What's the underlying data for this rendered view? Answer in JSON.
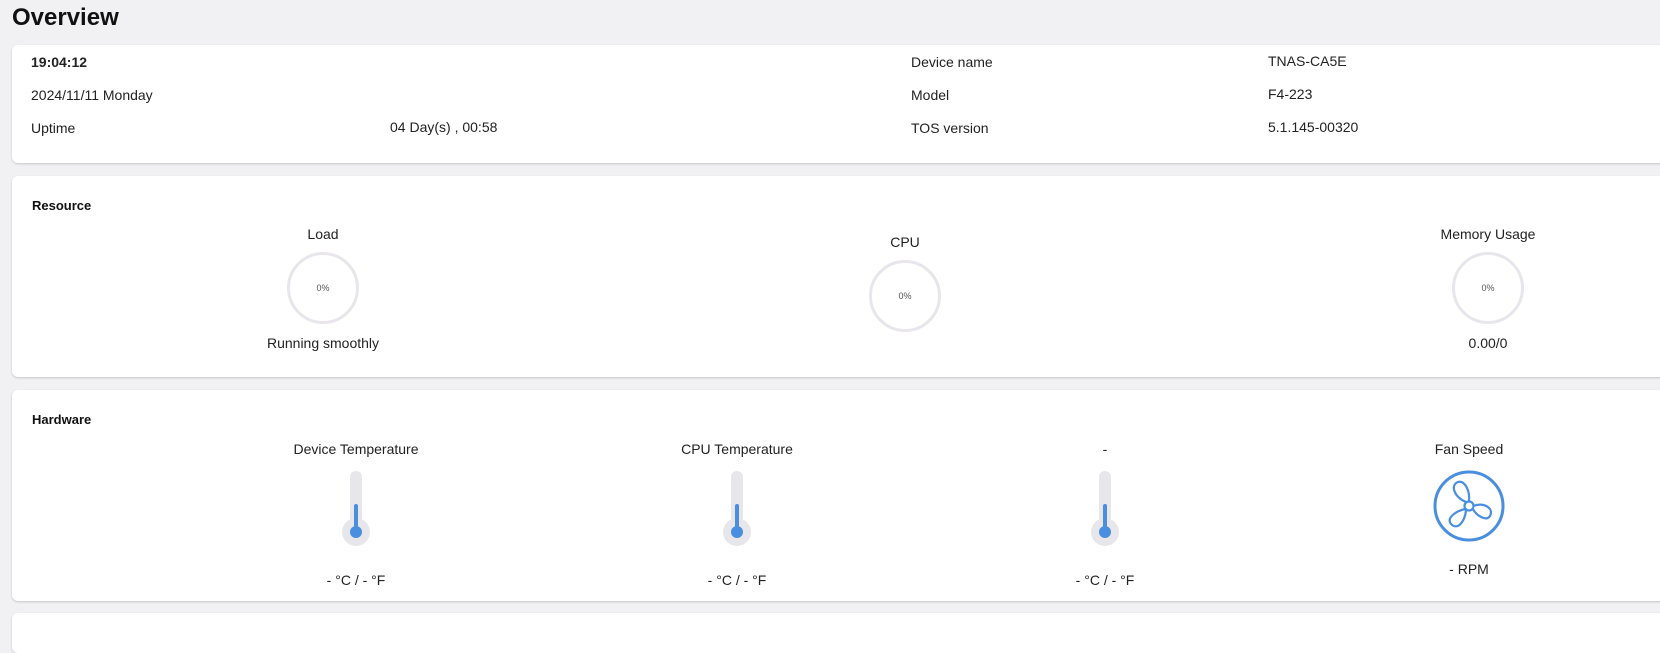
{
  "page": {
    "title": "Overview"
  },
  "info": {
    "time": "19:04:12",
    "date": "2024/11/11 Monday",
    "uptime_label": "Uptime",
    "uptime_value": "04 Day(s) , 00:58",
    "device_name_label": "Device name",
    "device_name_value": "TNAS-CA5E",
    "model_label": "Model",
    "model_value": "F4-223",
    "tos_label": "TOS version",
    "tos_value": "5.1.145-00320"
  },
  "resource": {
    "title": "Resource",
    "load": {
      "label": "Load",
      "percent_text": "0%",
      "status": "Running smoothly"
    },
    "cpu": {
      "label": "CPU",
      "percent_text": "0%"
    },
    "memory": {
      "label": "Memory Usage",
      "percent_text": "0%",
      "detail": "0.00/0"
    }
  },
  "hardware": {
    "title": "Hardware",
    "device_temp": {
      "label": "Device Temperature",
      "value": "- °C / - °F",
      "icon": "thermometer-icon"
    },
    "cpu_temp": {
      "label": "CPU Temperature",
      "value": "- °C / - °F",
      "icon": "thermometer-icon"
    },
    "other_temp": {
      "label": "-",
      "value": "- °C / - °F",
      "icon": "thermometer-icon"
    },
    "fan": {
      "label": "Fan Speed",
      "value": "- RPM",
      "icon": "fan-icon"
    }
  },
  "colors": {
    "accent": "#4a8ee0",
    "gauge_track": "#e8e6ec",
    "background": "#f1f0f3"
  }
}
